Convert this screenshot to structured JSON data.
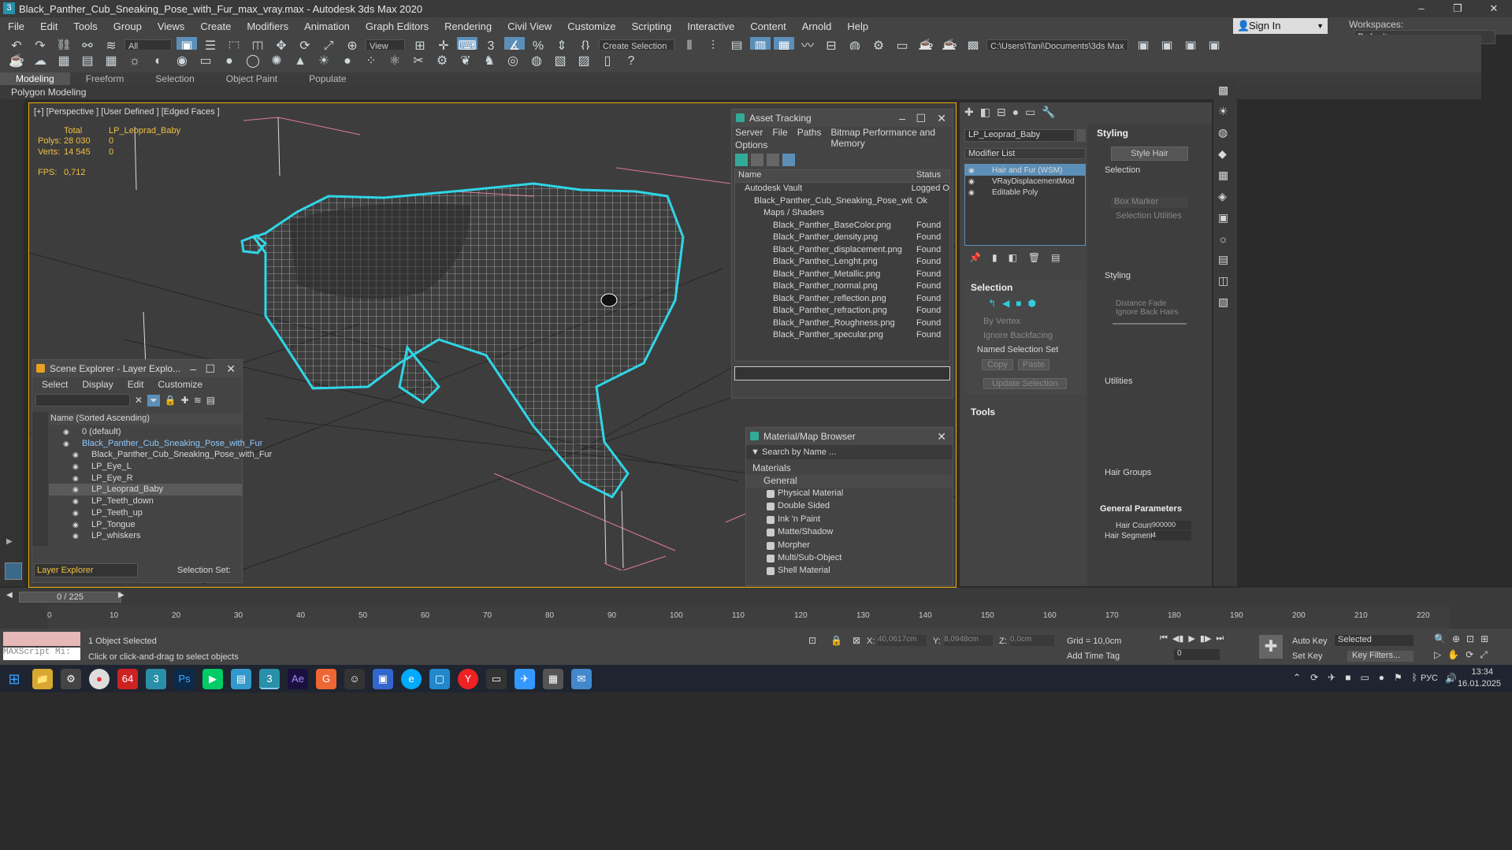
{
  "window": {
    "title": "Black_Panther_Cub_Sneaking_Pose_with_Fur_max_vray.max - Autodesk 3ds Max 2020"
  },
  "menu": [
    "File",
    "Edit",
    "Tools",
    "Group",
    "Views",
    "Create",
    "Modifiers",
    "Animation",
    "Graph Editors",
    "Rendering",
    "Civil View",
    "Customize",
    "Scripting",
    "Interactive",
    "Content",
    "Arnold",
    "Help"
  ],
  "account": {
    "sign_in": "Sign In",
    "workspaces_label": "Workspaces:",
    "workspace": "Default"
  },
  "toolbar": {
    "filter": "All",
    "view": "View",
    "selection_set": "Create Selection Se",
    "path": "C:\\Users\\Tani\\Documents\\3ds Max 2020"
  },
  "ribbon": {
    "tabs": [
      "Modeling",
      "Freeform",
      "Selection",
      "Object Paint",
      "Populate"
    ],
    "active": "Modeling",
    "sub": "Polygon Modeling"
  },
  "viewport": {
    "label": "[+] [Perspective ] [User Defined ] [Edged Faces ]",
    "stats_total": "Total",
    "stats_obj": "LP_Leoprad_Baby",
    "polys_label": "Polys:",
    "polys_total": "28 030",
    "polys_obj": "0",
    "verts_label": "Verts:",
    "verts_total": "14 545",
    "verts_obj": "0",
    "fps_label": "FPS:",
    "fps": "0,712"
  },
  "asset_tracking": {
    "title": "Asset Tracking",
    "menu": [
      "Server",
      "File",
      "Paths",
      "Bitmap Performance and Memory"
    ],
    "options": "Options",
    "col_name": "Name",
    "col_status": "Status",
    "rows": [
      {
        "name": "Autodesk Vault",
        "status": "Logged O",
        "indent": 1
      },
      {
        "name": "Black_Panther_Cub_Sneaking_Pose_wit...",
        "status": "Ok",
        "indent": 2
      },
      {
        "name": "Maps / Shaders",
        "status": "",
        "indent": 3
      },
      {
        "name": "Black_Panther_BaseColor.png",
        "status": "Found",
        "indent": 4
      },
      {
        "name": "Black_Panther_density.png",
        "status": "Found",
        "indent": 4
      },
      {
        "name": "Black_Panther_displacement.png",
        "status": "Found",
        "indent": 4
      },
      {
        "name": "Black_Panther_Lenght.png",
        "status": "Found",
        "indent": 4
      },
      {
        "name": "Black_Panther_Metallic.png",
        "status": "Found",
        "indent": 4
      },
      {
        "name": "Black_Panther_normal.png",
        "status": "Found",
        "indent": 4
      },
      {
        "name": "Black_Panther_reflection.png",
        "status": "Found",
        "indent": 4
      },
      {
        "name": "Black_Panther_refraction.png",
        "status": "Found",
        "indent": 4
      },
      {
        "name": "Black_Panther_Roughness.png",
        "status": "Found",
        "indent": 4
      },
      {
        "name": "Black_Panther_specular.png",
        "status": "Found",
        "indent": 4
      }
    ]
  },
  "scene_explorer": {
    "title": "Scene Explorer - Layer Explo...",
    "menu": [
      "Select",
      "Display",
      "Edit",
      "Customize"
    ],
    "col": "Name (Sorted Ascending)",
    "rows": [
      {
        "name": "0 (default)",
        "indent": 1
      },
      {
        "name": "Black_Panther_Cub_Sneaking_Pose_with_Fur",
        "indent": 1,
        "hl": true
      },
      {
        "name": "Black_Panther_Cub_Sneaking_Pose_with_Fur",
        "indent": 2
      },
      {
        "name": "LP_Eye_L",
        "indent": 2
      },
      {
        "name": "LP_Eye_R",
        "indent": 2
      },
      {
        "name": "LP_Leoprad_Baby",
        "indent": 2,
        "sel": true
      },
      {
        "name": "LP_Teeth_down",
        "indent": 2
      },
      {
        "name": "LP_Teeth_up",
        "indent": 2
      },
      {
        "name": "LP_Tongue",
        "indent": 2
      },
      {
        "name": "LP_whiskers",
        "indent": 2
      }
    ],
    "footer_dropdown": "Layer Explorer",
    "selection_set": "Selection Set:"
  },
  "material_browser": {
    "title": "Material/Map Browser",
    "search": "Search by Name ...",
    "materials": "Materials",
    "general": "General",
    "items": [
      "Physical Material",
      "Double Sided",
      "Ink 'n Paint",
      "Matte/Shadow",
      "Morpher",
      "Multi/Sub-Object",
      "Shell Material"
    ]
  },
  "command_panel": {
    "object_name": "LP_Leoprad_Baby",
    "modifier_list": "Modifier List",
    "stack": [
      {
        "name": "Hair and Fur (WSM)",
        "sel": true
      },
      {
        "name": "VRayDisplacementMod",
        "sel": false
      },
      {
        "name": "Editable Poly",
        "sel": false
      }
    ],
    "selection_title": "Selection",
    "by_vertex": "By Vertex",
    "ignore_backfacing": "Ignore Backfacing",
    "named_sel": "Named Selection Set",
    "copy": "Copy",
    "paste": "Paste",
    "update_sel": "Update Selection",
    "tools_title": "Tools"
  },
  "styling": {
    "title": "Styling",
    "style_hair": "Style Hair",
    "selection": "Selection",
    "box_marker": "Box Marker",
    "sel_utils": "Selection Utilities",
    "styling_sub": "Styling",
    "distance_fade": "Distance Fade",
    "ignore_back_hairs": "Ignore Back Hairs",
    "utilities": "Utilities",
    "hair_groups": "Hair Groups",
    "general_params": "General Parameters",
    "hair_count_label": "Hair Count",
    "hair_count": "900000",
    "hair_segments_label": "Hair Segments",
    "hair_segments": "4"
  },
  "timeline": {
    "frame": "0 / 225",
    "ticks": [
      "0",
      "10",
      "20",
      "30",
      "40",
      "50",
      "60",
      "70",
      "80",
      "90",
      "100",
      "110",
      "120",
      "130",
      "140",
      "150",
      "160",
      "170",
      "180",
      "190",
      "200",
      "210",
      "220"
    ]
  },
  "status": {
    "maxscript": "MAXScript Mi:",
    "selected": "1 Object Selected",
    "hint": "Click or click-and-drag to select objects",
    "x_label": "X:",
    "x": "40,0617cm",
    "y_label": "Y:",
    "y": "8,0948cm",
    "z_label": "Z:",
    "z": "0,0cm",
    "grid": "Grid = 10,0cm",
    "add_time_tag": "Add Time Tag",
    "auto_key": "Auto Key",
    "set_key": "Set Key",
    "key_mode": "Selected",
    "key_filters": "Key Filters...",
    "frame_field": "0"
  },
  "taskbar": {
    "lang": "РУС",
    "time": "13:34",
    "date": "16.01.2025",
    "app_64": "64"
  },
  "colors": {
    "accent": "#5c8fb8",
    "viewport_border": "#f0b000",
    "wire": "#ffffff",
    "fur": "#2fd6e6",
    "grid": "#1a1a1a",
    "pink": "#e07a9a"
  }
}
